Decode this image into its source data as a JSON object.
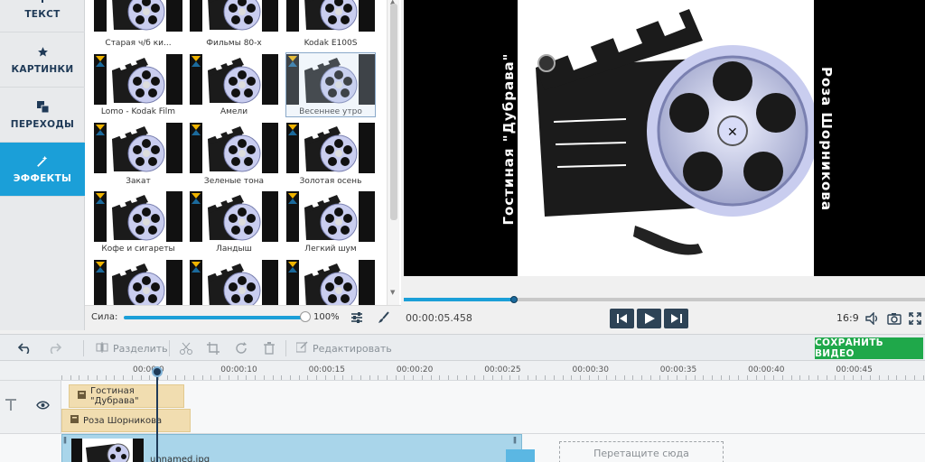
{
  "sidebar": {
    "items": [
      {
        "label": "ТЕКСТ",
        "icon": "text-icon",
        "active": false
      },
      {
        "label": "КАРТИНКИ",
        "icon": "star-icon",
        "active": false
      },
      {
        "label": "ПЕРЕХОДЫ",
        "icon": "transitions-icon",
        "active": false
      },
      {
        "label": "ЭФФЕКТЫ",
        "icon": "magic-wand-icon",
        "active": true
      }
    ]
  },
  "effects": {
    "rows": [
      [
        "Старая ч/б ки...",
        "Фильмы 80-х",
        "Kodak E100S"
      ],
      [
        "Lomo - Kodak Film",
        "Амели",
        "Весеннее утро"
      ],
      [
        "Закат",
        "Зеленые тона",
        "Золотая осень"
      ],
      [
        "Кофе и сигареты",
        "Ландыш",
        "Легкий шум"
      ],
      [
        "",
        "",
        ""
      ]
    ],
    "selected": "Весеннее утро",
    "strength_label": "Сила:",
    "strength_value": "100%",
    "strength_fraction": 1.0
  },
  "preview": {
    "left_text": "Гостиная \"Дубрава\"",
    "right_text": "Роза Шорникова",
    "timecode": "00:00:05.458",
    "aspect_ratio": "16:9",
    "progress_fraction": 0.21
  },
  "toolbar": {
    "split_label": "Разделить",
    "edit_label": "Редактировать",
    "save_label": "СОХРАНИТЬ ВИДЕО"
  },
  "timeline": {
    "ruler_labels": [
      "00:00:0",
      "00:00:10",
      "00:00:15",
      "00:00:20",
      "00:00:25",
      "00:00:30",
      "00:00:35",
      "00:00:40",
      "00:00:45"
    ],
    "text_clips": [
      "Гостиная \"Дубрава\"",
      "Роза Шорникова"
    ],
    "video_clip_name": "unnamed.jpg",
    "drop_zone_text": "Перетащите сюда"
  },
  "colors": {
    "accent": "#1b9fd8",
    "save": "#1fa84a",
    "text_clip": "#f1ddb0",
    "video_clip": "#a9d5ea"
  }
}
